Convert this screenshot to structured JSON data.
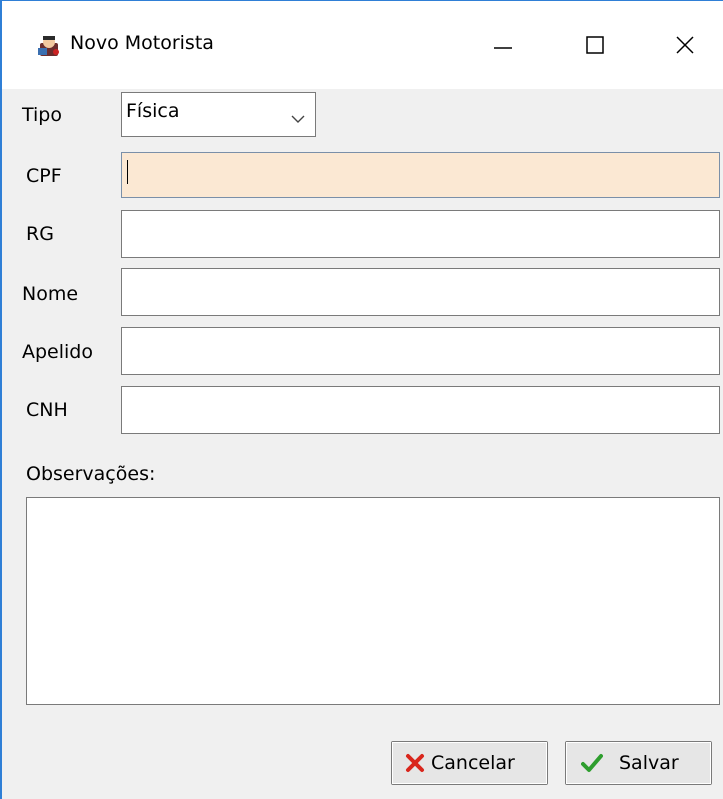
{
  "window": {
    "title": "Novo Motorista",
    "icon": "driver-app-icon",
    "controls": {
      "minimize": "minimize-icon",
      "maximize": "maximize-icon",
      "close": "close-icon"
    }
  },
  "form": {
    "tipo": {
      "label": "Tipo",
      "value": "Física",
      "icon": "chevron-down-icon"
    },
    "cpf": {
      "label": "CPF",
      "value": ""
    },
    "rg": {
      "label": "RG",
      "value": ""
    },
    "nome": {
      "label": "Nome",
      "value": ""
    },
    "apelido": {
      "label": "Apelido",
      "value": ""
    },
    "cnh": {
      "label": "CNH",
      "value": ""
    },
    "observacoes": {
      "label": "Observações:",
      "value": ""
    }
  },
  "buttons": {
    "cancel": {
      "label": "Cancelar",
      "icon": "x-icon",
      "icon_color": "#d9261c"
    },
    "save": {
      "label": "Salvar",
      "icon": "checkmark-icon",
      "icon_color": "#2e9e2e"
    }
  },
  "colors": {
    "focused_field_bg": "#fbe8d3",
    "window_border": "#2f7fd6"
  }
}
